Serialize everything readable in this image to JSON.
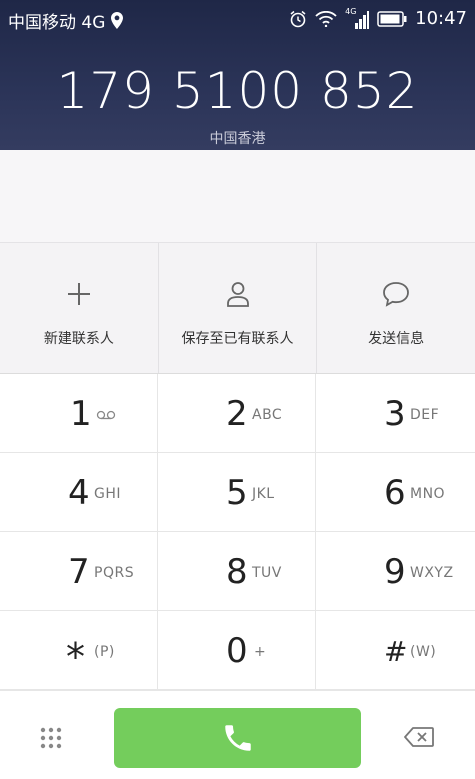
{
  "status_bar": {
    "carrier": "中国移动 4G",
    "time": "10:47",
    "signal_label": "4G",
    "icons": [
      "location-pin-icon",
      "alarm-icon",
      "wifi-icon",
      "signal-icon",
      "battery-icon"
    ]
  },
  "dialer": {
    "number": "179 5100 852",
    "location": "中国香港"
  },
  "actions": [
    {
      "label": "新建联系人",
      "icon": "plus-icon"
    },
    {
      "label": "保存至已有联系人",
      "icon": "person-icon"
    },
    {
      "label": "发送信息",
      "icon": "message-icon"
    }
  ],
  "keys": [
    {
      "digit": "1",
      "letters": ""
    },
    {
      "digit": "2",
      "letters": "ABC"
    },
    {
      "digit": "3",
      "letters": "DEF"
    },
    {
      "digit": "4",
      "letters": "GHI"
    },
    {
      "digit": "5",
      "letters": "JKL"
    },
    {
      "digit": "6",
      "letters": "MNO"
    },
    {
      "digit": "7",
      "letters": "PQRS"
    },
    {
      "digit": "8",
      "letters": "TUV"
    },
    {
      "digit": "9",
      "letters": "WXYZ"
    },
    {
      "digit": "*",
      "letters": "(P)"
    },
    {
      "digit": "0",
      "letters": "+"
    },
    {
      "digit": "#",
      "letters": "(W)"
    }
  ],
  "bottom": {
    "icons": [
      "dialpad-toggle-icon",
      "phone-icon",
      "backspace-icon"
    ],
    "call_color": "#74cd5c"
  },
  "colors": {
    "header_bg": "#2b3458",
    "accent_green": "#74cd5c"
  }
}
